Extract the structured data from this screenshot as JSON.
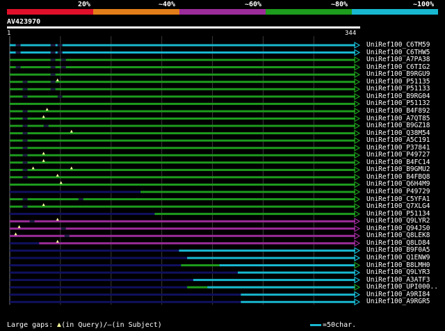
{
  "legend": {
    "labels": [
      "20%",
      "~40%",
      "~60%",
      "~80%",
      "~100%"
    ],
    "colors": [
      "#e0102a",
      "#e27e19",
      "#9c2c9a",
      "#1d9c1d",
      "#18b8d0"
    ]
  },
  "query": {
    "title": "AV423970",
    "start": "1",
    "end": "344",
    "length": 344
  },
  "colors": {
    "cyan": "#18b8d0",
    "green": "#1d9c1d",
    "purple": "#9c2c9a",
    "dark": "#101060",
    "gap": "#ffffa0"
  },
  "hits": [
    {
      "label": "UniRef100_C6TM59",
      "color": "cyan",
      "start": 1,
      "gaps": [
        2,
        12,
        14
      ],
      "tri": []
    },
    {
      "label": "UniRef100_C6THW5",
      "color": "cyan",
      "start": 1,
      "gaps": [
        2,
        12,
        14
      ],
      "tri": []
    },
    {
      "label": "UniRef100_A7PA38",
      "color": "green",
      "start": 1,
      "gaps": [
        12,
        15
      ],
      "tri": []
    },
    {
      "label": "UniRef100_C6TIG2",
      "color": "green",
      "start": 1,
      "gaps": [
        2,
        12,
        15
      ],
      "tri": []
    },
    {
      "label": "UniRef100_B9RGU9",
      "color": "green",
      "start": 1,
      "gaps": [
        12
      ],
      "tri": []
    },
    {
      "label": "UniRef100_P51135",
      "color": "green",
      "start": 1,
      "gaps": [
        4,
        12
      ],
      "tri": [
        14
      ]
    },
    {
      "label": "UniRef100_P51133",
      "color": "green",
      "start": 1,
      "gaps": [
        4,
        12
      ],
      "tri": []
    },
    {
      "label": "UniRef100_B9RG04",
      "color": "green",
      "start": 1,
      "gaps": [
        4,
        14
      ],
      "tri": []
    },
    {
      "label": "UniRef100_P51132",
      "color": "green",
      "start": 1,
      "gaps": [],
      "tri": []
    },
    {
      "label": "UniRef100_B4F892",
      "color": "green",
      "start": 1,
      "gaps": [
        4
      ],
      "tri": [
        11
      ]
    },
    {
      "label": "UniRef100_A7QT85",
      "color": "green",
      "start": 1,
      "gaps": [
        4
      ],
      "tri": [
        10
      ]
    },
    {
      "label": "UniRef100_B9GZ18",
      "color": "green",
      "start": 1,
      "gaps": [
        4,
        10
      ],
      "tri": []
    },
    {
      "label": "UniRef100_Q38M54",
      "color": "green",
      "start": 1,
      "gaps": [
        4
      ],
      "tri": [
        18
      ]
    },
    {
      "label": "UniRef100_A5C191",
      "color": "green",
      "start": 1,
      "gaps": [
        4
      ],
      "tri": []
    },
    {
      "label": "UniRef100_P37841",
      "color": "green",
      "start": 1,
      "gaps": [
        4
      ],
      "tri": []
    },
    {
      "label": "UniRef100_P49727",
      "color": "green",
      "start": 1,
      "gaps": [
        4
      ],
      "tri": [
        10
      ]
    },
    {
      "label": "UniRef100_B4FC14",
      "color": "green",
      "start": 1,
      "gaps": [
        4
      ],
      "tri": [
        10
      ]
    },
    {
      "label": "UniRef100_B9GMU2",
      "color": "green",
      "start": 1,
      "gaps": [
        4
      ],
      "tri": [
        7,
        18
      ]
    },
    {
      "label": "UniRef100_B4FBQ8",
      "color": "green",
      "start": 1,
      "gaps": [
        4
      ],
      "tri": [
        14
      ]
    },
    {
      "label": "UniRef100_Q6H4M9",
      "color": "green",
      "start": 1,
      "gaps": [],
      "tri": [
        15
      ]
    },
    {
      "label": "UniRef100_P49729",
      "color": "green",
      "start": 1,
      "gaps": [],
      "tri": [],
      "dark_to": 130
    },
    {
      "label": "UniRef100_C5YFA1",
      "color": "green",
      "start": 1,
      "gaps": [
        4,
        20
      ],
      "tri": []
    },
    {
      "label": "UniRef100_Q7XLG4",
      "color": "green",
      "start": 1,
      "gaps": [
        4
      ],
      "tri": [
        10
      ]
    },
    {
      "label": "UniRef100_P51134",
      "color": "green",
      "start": 144,
      "gaps": [],
      "tri": []
    },
    {
      "label": "UniRef100_Q9LYR2",
      "color": "purple",
      "start": 1,
      "gaps": [
        6
      ],
      "tri": [
        14
      ]
    },
    {
      "label": "UniRef100_Q94JS0",
      "color": "purple",
      "start": 1,
      "gaps": [
        15
      ],
      "tri": [
        3
      ]
    },
    {
      "label": "UniRef100_Q8LEK8",
      "color": "purple",
      "start": 1,
      "gaps": [
        16
      ],
      "tri": [
        2
      ]
    },
    {
      "label": "UniRef100_Q8LD84",
      "color": "purple",
      "start": 1,
      "gaps": [],
      "tri": [
        14
      ],
      "dark_to": 30
    },
    {
      "label": "UniRef100_B9F0A5",
      "color": "cyan",
      "start": 168,
      "gaps": [],
      "tri": []
    },
    {
      "label": "UniRef100_Q1ENW9",
      "color": "cyan",
      "start": 176,
      "gaps": [],
      "tri": []
    },
    {
      "label": "UniRef100_B8LMH0",
      "color": "green",
      "start": 170,
      "gaps": [],
      "tri": [],
      "cyan_from": 208
    },
    {
      "label": "UniRef100_Q9LYR3",
      "color": "cyan",
      "start": 226,
      "gaps": [],
      "tri": []
    },
    {
      "label": "UniRef100_A3ATF3",
      "color": "cyan",
      "start": 182,
      "gaps": [],
      "tri": []
    },
    {
      "label": "UniRef100_UPI000..",
      "color": "green",
      "start": 176,
      "gaps": [],
      "tri": [],
      "cyan_from": 196
    },
    {
      "label": "UniRef100_A9RI84",
      "color": "cyan",
      "start": 229,
      "gaps": [],
      "tri": []
    },
    {
      "label": "UniRef100_A9RGR5",
      "color": "cyan",
      "start": 229,
      "gaps": [],
      "tri": []
    }
  ],
  "footer": {
    "gaps_prefix": "Large gaps:",
    "gaps_query": "(in Query)/",
    "gaps_subject_glyph": "—",
    "gaps_subject": "(in Subject)",
    "scale_text": "=50char."
  }
}
